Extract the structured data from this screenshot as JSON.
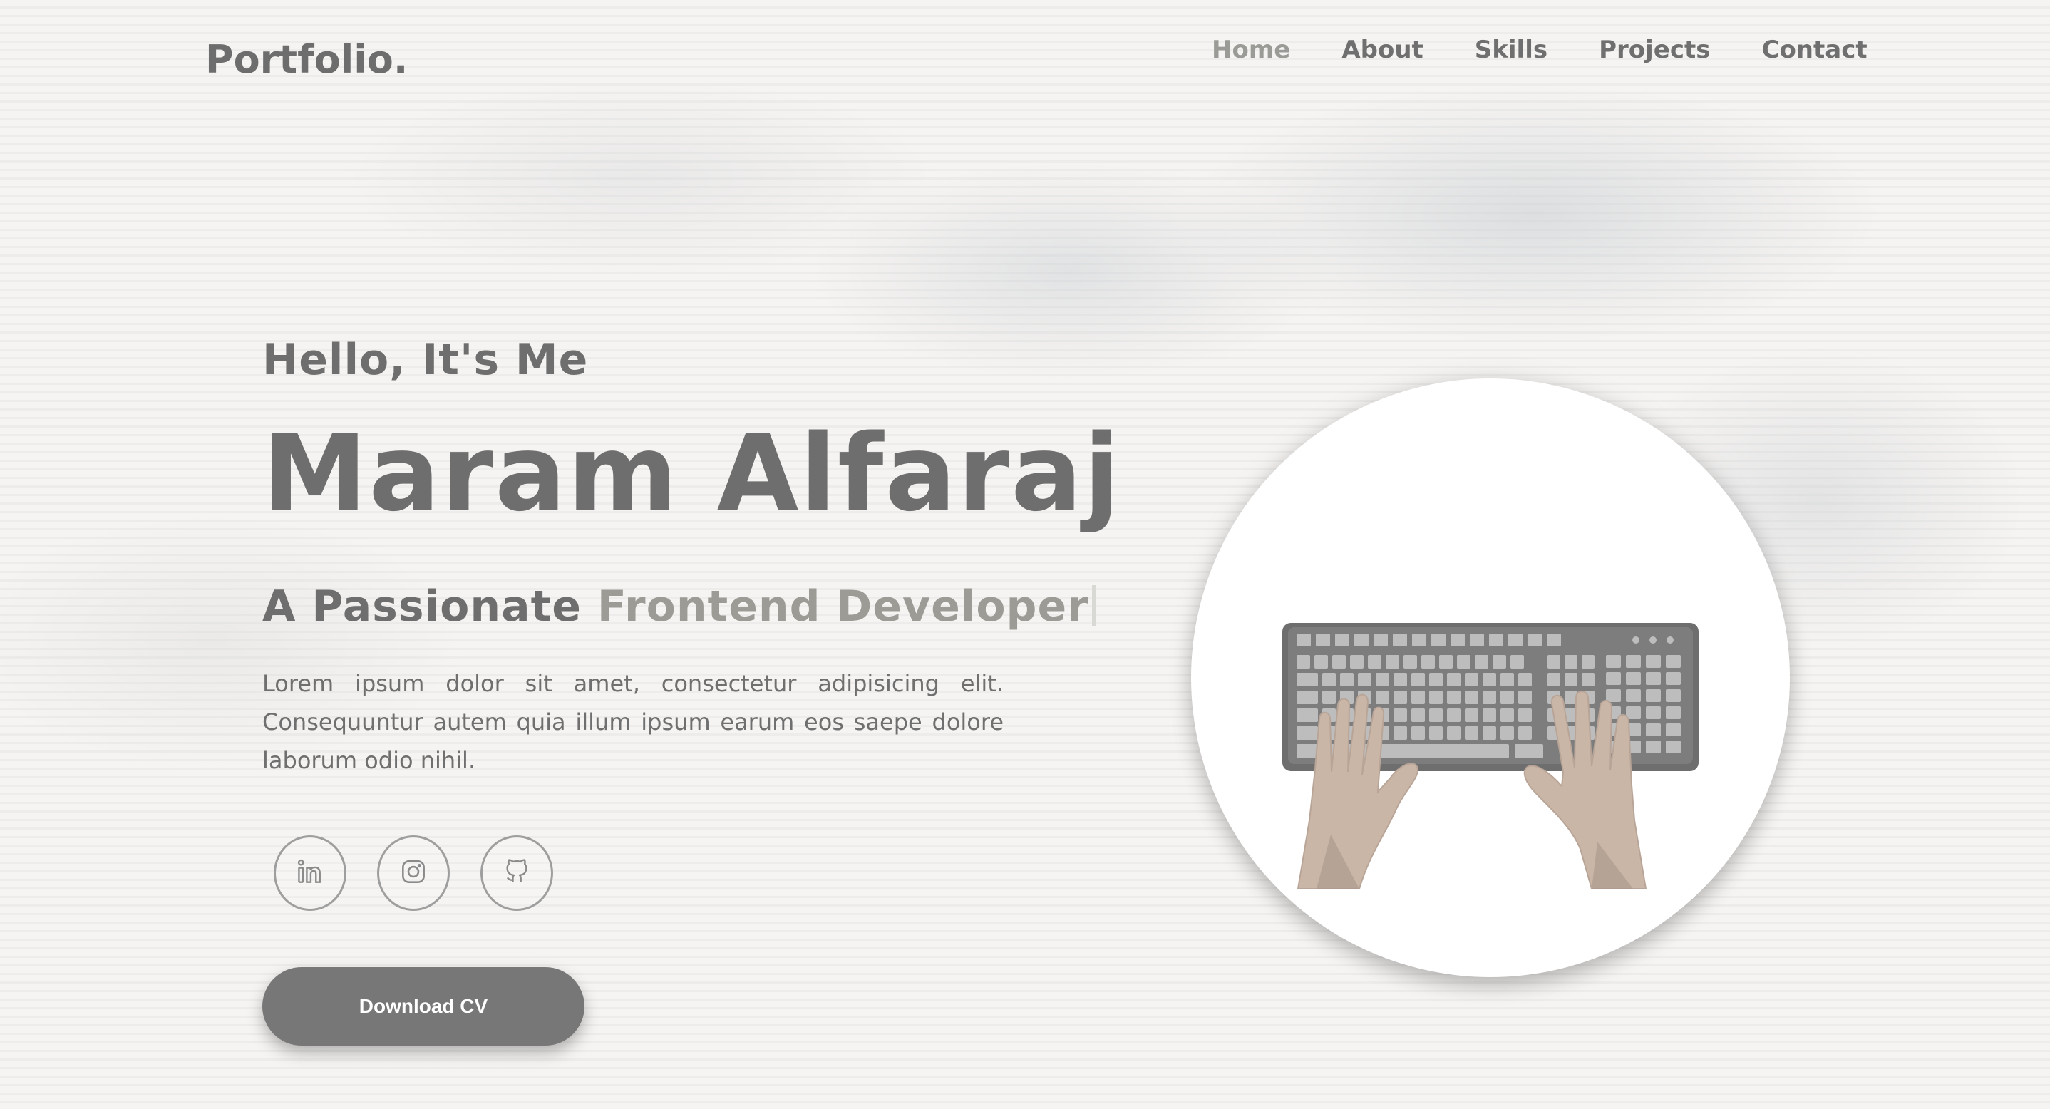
{
  "header": {
    "logo": "Portfolio.",
    "nav": [
      {
        "label": "Home",
        "active": true
      },
      {
        "label": "About",
        "active": false
      },
      {
        "label": "Skills",
        "active": false
      },
      {
        "label": "Projects",
        "active": false
      },
      {
        "label": "Contact",
        "active": false
      }
    ]
  },
  "hero": {
    "greeting": "Hello, It's Me",
    "name": "Maram Alfaraj",
    "tagline_lead": "A Passionate",
    "tagline_role": "Frontend Developer",
    "description": "Lorem ipsum dolor sit amet, consectetur adipisicing elit. Consequuntur autem quia illum ipsum earum eos saepe dolore laborum odio nihil.",
    "download_label": "Download CV"
  },
  "social": [
    {
      "icon": "linkedin-icon"
    },
    {
      "icon": "instagram-icon"
    },
    {
      "icon": "github-icon"
    }
  ],
  "illustration": {
    "icon": "keyboard-typing-hands-icon"
  },
  "colors": {
    "text": "#6e6e6e",
    "accent": "#9c9b95",
    "button": "#777777",
    "background": "#f6f4f2"
  }
}
